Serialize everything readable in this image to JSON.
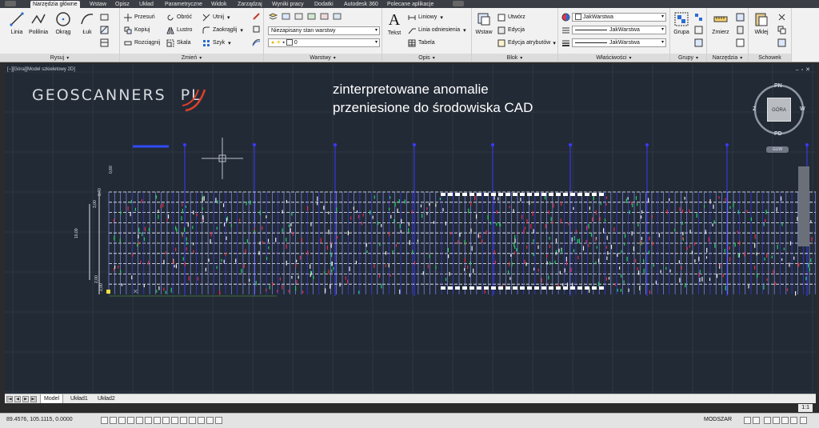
{
  "ribbon_tabs": [
    "Narzędzia główne",
    "Wstaw",
    "Opisz",
    "Układ",
    "Parametryczne",
    "Widok",
    "Zarządzaj",
    "Wyniki pracy",
    "Dodatki",
    "Autodesk 360",
    "Polecane aplikacje"
  ],
  "draw": {
    "line": "Linia",
    "polyline": "Polilinia",
    "circle": "Okrąg",
    "arc": "Łuk",
    "title": "Rysuj"
  },
  "modify": {
    "move": "Przesuń",
    "rotate": "Obróć",
    "trim": "Utnij",
    "copy": "Kopiuj",
    "mirror": "Lustro",
    "fillet": "Zaokrąglij",
    "stretch": "Rozciągnij",
    "scale": "Skala",
    "array": "Szyk",
    "title": "Zmień"
  },
  "layers": {
    "state": "Niezapisany stan warstwy",
    "current": "0",
    "title": "Warstwy"
  },
  "annotation": {
    "text": "Tekst",
    "linear": "Liniowy",
    "leader": "Linia odniesienia",
    "table": "Tabela",
    "title": "Opis"
  },
  "block": {
    "insert": "Wstaw",
    "create": "Utwórz",
    "edit": "Edycja",
    "edit_attr": "Edycja atrybutów",
    "title": "Blok"
  },
  "properties": {
    "color": "JakWarstwa",
    "linetype": "JakWarstwa",
    "lineweight": "JakWarstwa",
    "title": "Właściwości"
  },
  "groups": {
    "group": "Grupa",
    "title": "Grupy"
  },
  "utilities": {
    "measure": "Zmierz",
    "title": "Narzędzia"
  },
  "clipboard": {
    "paste": "Wklej",
    "title": "Schowek"
  },
  "viewport": {
    "label": "[−][Góra][Model szkieletowy 2D]"
  },
  "logo": {
    "left": "GEOSCANNERS",
    "right": "PL"
  },
  "annotation_text": {
    "line1": "zinterpretowane anomalie",
    "line2": "przeniesione do środowiska CAD"
  },
  "viewcube": {
    "n": "PN",
    "s": "PD",
    "e": "W",
    "w": "Z",
    "face": "GÓRA",
    "wcs": "GUW"
  },
  "dims": {
    "d1": "0,60",
    "d2": "3,40",
    "d3": "3,00",
    "d4": "10,00",
    "d5": "2,00",
    "d6": "2,00"
  },
  "layout_tabs": [
    "Model",
    "Układ1",
    "Układ2"
  ],
  "status": {
    "coords": "89.4576, 105.1115, 0.0000",
    "space": "MODSZAR",
    "scale": "1:1"
  },
  "colors": {
    "canvas": "#222a35",
    "grid": "#ffffff",
    "grid_cols": "#3a3aff",
    "marks_green": "#22d066",
    "marks_red": "#e0304a",
    "marks_white": "#f0f0f0"
  }
}
